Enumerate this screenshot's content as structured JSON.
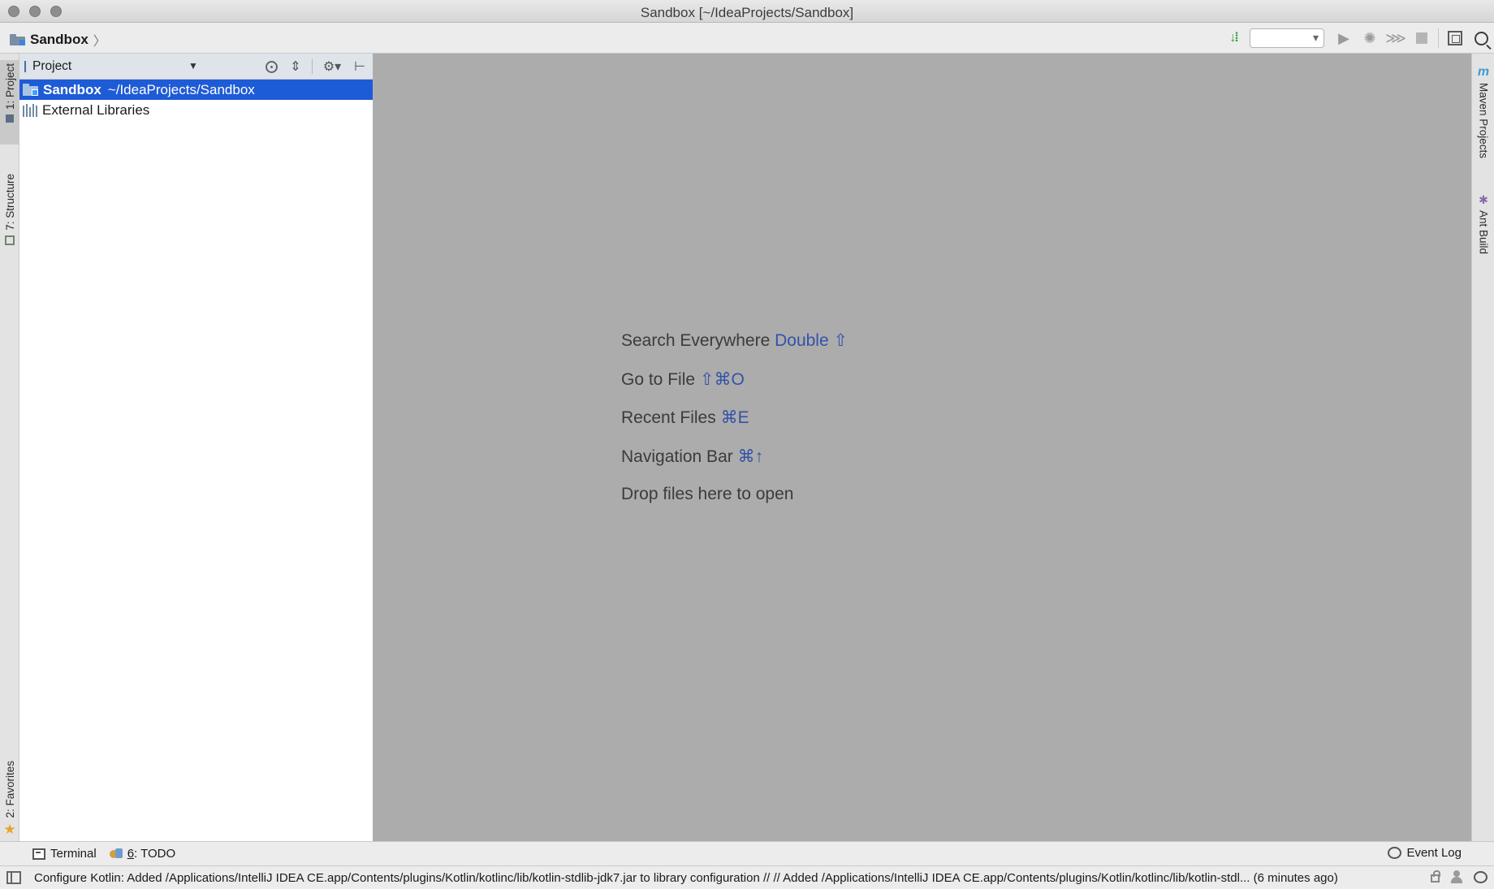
{
  "window": {
    "title": "Sandbox [~/IdeaProjects/Sandbox]"
  },
  "navbar": {
    "breadcrumb": "Sandbox",
    "breadcrumb_separator": "〉",
    "icons": [
      "sort-icon",
      "run-config-dropdown",
      "run-icon",
      "debug-icon",
      "coverage-icon",
      "stop-icon",
      "project-structure-icon",
      "search-icon"
    ]
  },
  "left_stripe": {
    "project_tab": "1: Project",
    "structure_tab": "7: Structure",
    "favorites_tab": "2: Favorites"
  },
  "project_panel": {
    "title": "Project",
    "dropdown_glyph": "▼",
    "gear_glyph": "⚙▾",
    "hide_glyph": "⊢",
    "collapse_glyph": "⇕",
    "tree": [
      {
        "name": "Sandbox",
        "path": "~/IdeaProjects/Sandbox",
        "selected": true
      },
      {
        "name": "External Libraries"
      }
    ]
  },
  "editor": {
    "hints": [
      {
        "text": "Search Everywhere",
        "shortcut": "Double ⇧"
      },
      {
        "text": "Go to File",
        "shortcut": "⇧⌘O"
      },
      {
        "text": "Recent Files",
        "shortcut": "⌘E"
      },
      {
        "text": "Navigation Bar",
        "shortcut": "⌘↑"
      },
      {
        "text": "Drop files here to open",
        "shortcut": ""
      }
    ],
    "shortcut_color": "#3352a8"
  },
  "right_stripe": {
    "maven_tab": "Maven Projects",
    "ant_tab": "Ant Build",
    "maven_glyph": "m"
  },
  "tool_windows": {
    "terminal": "Terminal",
    "todo_mnemonic": "6",
    "todo_label": ": TODO",
    "event_log": "Event Log"
  },
  "status_bar": {
    "message": "Configure Kotlin: Added /Applications/IntelliJ IDEA CE.app/Contents/plugins/Kotlin/kotlinc/lib/kotlin-stdlib-jdk7.jar to library configuration // // Added /Applications/IntelliJ IDEA CE.app/Contents/plugins/Kotlin/kotlinc/lib/kotlin-stdl... (6 minutes ago)"
  },
  "colors": {
    "selection": "#1e5bd6",
    "editor_bg": "#acacac",
    "panel_header": "#dfe4ea"
  }
}
